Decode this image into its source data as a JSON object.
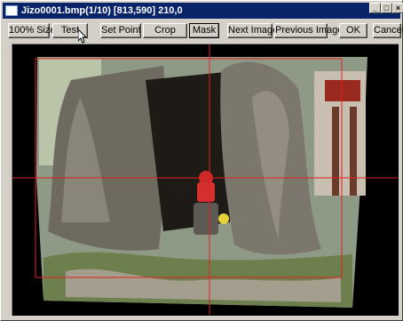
{
  "window": {
    "title": "Jizo0001.bmp(1/10) [813,590] 210,0"
  },
  "titlebar_buttons": {
    "minimize": "_",
    "maximize": "□",
    "close": "×"
  },
  "toolbar": {
    "size_100": "100% Size",
    "test": "Test",
    "set_point": "Set Point",
    "crop": "Crop",
    "mask": "Mask",
    "next_image": "Next Image",
    "previous_image": "Previous Image",
    "ok": "OK",
    "cancel": "Cancel"
  },
  "colors": {
    "title_bar": "#0a246a",
    "window_face": "#d4d0c8",
    "guide_lines": "#e02020"
  }
}
